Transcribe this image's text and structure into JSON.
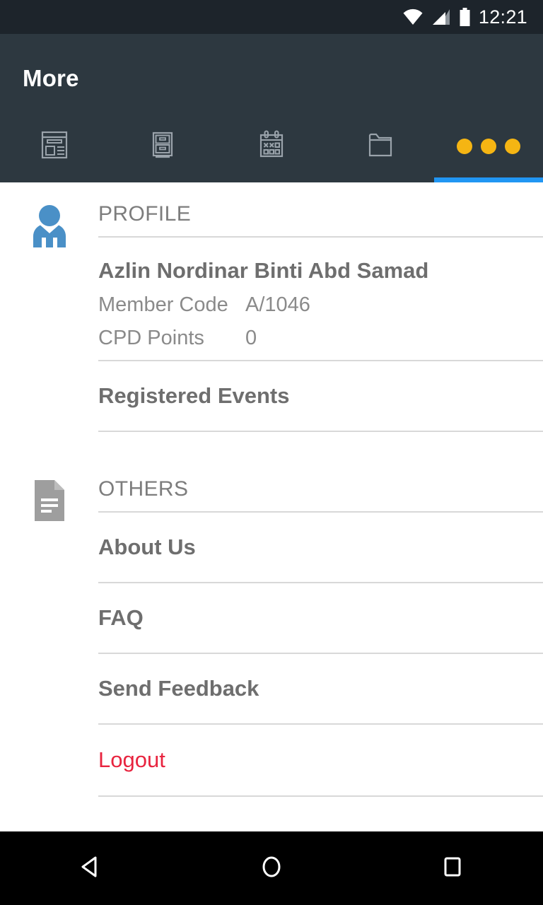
{
  "status_bar": {
    "time": "12:21",
    "icons": [
      "wifi-icon",
      "cellular-signal-icon",
      "battery-icon"
    ]
  },
  "app_bar": {
    "title": "More",
    "active_tab_index": 4,
    "active_indicator_color": "#2196f3",
    "background_color": "#2d3840",
    "tabs": [
      {
        "name": "news-tab",
        "icon": "newspaper-icon",
        "label": ""
      },
      {
        "name": "cabinet-tab",
        "icon": "filing-cabinet-icon",
        "label": ""
      },
      {
        "name": "events-tab",
        "icon": "calendar-icon",
        "label": ""
      },
      {
        "name": "documents-tab",
        "icon": "folder-icon",
        "label": ""
      },
      {
        "name": "more-tab",
        "icon": "three-dots-icon",
        "label": ""
      }
    ],
    "dots_color": "#f5b513"
  },
  "profile_section": {
    "icon": "person-icon",
    "icon_color": "#4a90c7",
    "header": "PROFILE",
    "name": "Azlin Nordinar Binti Abd Samad",
    "fields": [
      {
        "key": "Member Code",
        "value": "A/1046"
      },
      {
        "key": "CPD Points",
        "value": "0"
      }
    ],
    "registered_events_label": "Registered Events"
  },
  "others_section": {
    "icon": "document-icon",
    "icon_color": "#9e9e9e",
    "header": "OTHERS",
    "items": [
      {
        "label": "About Us"
      },
      {
        "label": "FAQ"
      },
      {
        "label": "Send Feedback"
      }
    ],
    "logout_label": "Logout",
    "logout_color": "#e8243f"
  },
  "nav_bar": {
    "back": "back-triangle-icon",
    "home": "home-circle-icon",
    "recents": "recents-square-icon"
  }
}
